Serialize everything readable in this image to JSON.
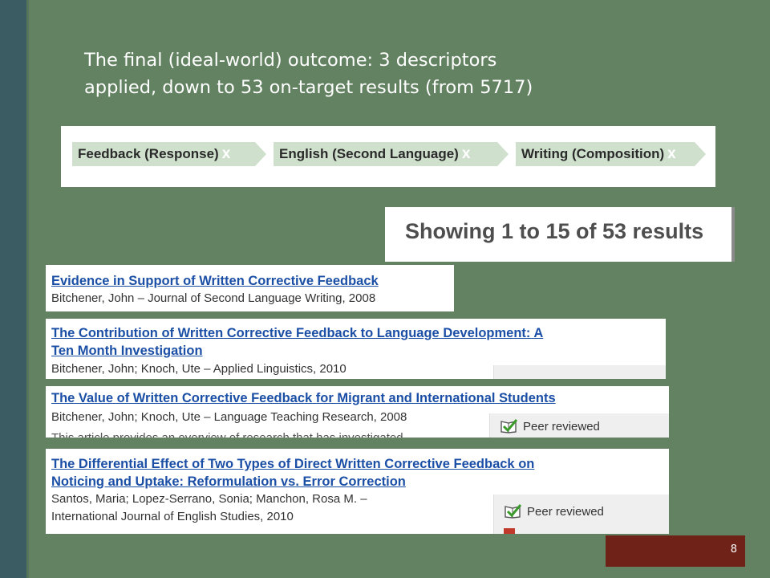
{
  "slide": {
    "title_line1": "The final (ideal-world) outcome: 3 descriptors",
    "title_line2": "applied, down to 53 on-target results (from 5717)",
    "page_number": "8"
  },
  "filters": [
    {
      "label": "Feedback (Response)",
      "remove": "x"
    },
    {
      "label": "English (Second Language)",
      "remove": "x"
    },
    {
      "label": "Writing (Composition)",
      "remove": "x"
    }
  ],
  "results_count": "Showing 1 to 15 of 53 results",
  "results": [
    {
      "title_line1": "Evidence in Support of Written Corrective Feedback",
      "meta_line1": "Bitchener, John – Journal of Second Language Writing, 2008"
    },
    {
      "title_line1": "The Contribution of Written Corrective Feedback to Language Development: A",
      "title_line2": "Ten Month Investigation",
      "meta_line1": "Bitchener, John; Knoch, Ute – Applied Linguistics, 2010"
    },
    {
      "title_line1": "The Value of Written Corrective Feedback for Migrant and International Students",
      "meta_line1": "Bitchener, John; Knoch, Ute – Language Teaching Research, 2008",
      "snippet": "This article provides an overview of research that has investigated",
      "badge": "Peer reviewed"
    },
    {
      "title_line1": "The Differential Effect of Two Types of Direct Written Corrective Feedback on",
      "title_line2": "Noticing and Uptake: Reformulation vs. Error Correction",
      "meta_line1": "Santos, Maria; Lopez-Serrano, Sonia; Manchon, Rosa M. –",
      "meta_line2": "International Journal of English Studies, 2010",
      "badge": "Peer reviewed"
    }
  ],
  "icons": {
    "peer_reviewed": "peer-reviewed-check-icon",
    "remove_filter": "remove-x-icon"
  },
  "colors": {
    "link": "#1b4fa6",
    "chip": "#cfe0cd",
    "background": "#628261",
    "page_box": "#6e2218"
  }
}
